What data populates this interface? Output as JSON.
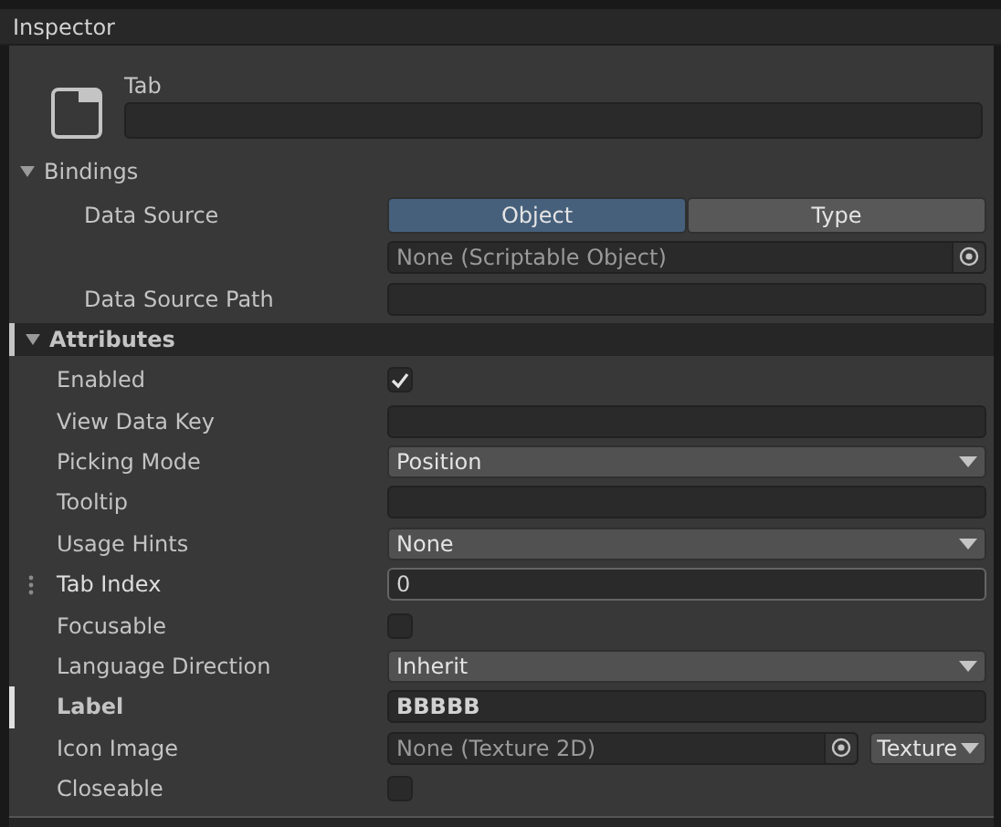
{
  "panel": {
    "title": "Inspector"
  },
  "element": {
    "type_name": "Tab"
  },
  "bindings": {
    "title": "Bindings",
    "expanded": true,
    "data_source": {
      "label": "Data Source",
      "options": [
        {
          "label": "Object",
          "selected": true
        },
        {
          "label": "Type",
          "selected": false
        }
      ],
      "value": "None (Scriptable Object)"
    },
    "data_source_path": {
      "label": "Data Source Path"
    }
  },
  "attributes": {
    "title": "Attributes",
    "expanded": true,
    "rows": [
      {
        "kind": "checkbox",
        "label": "Enabled",
        "checked": true,
        "modified": false,
        "hovered": false
      },
      {
        "kind": "text",
        "label": "View Data Key",
        "modified": false,
        "hovered": false
      },
      {
        "kind": "dropdown",
        "label": "Picking Mode",
        "value": "Position",
        "modified": false,
        "hovered": false
      },
      {
        "kind": "text",
        "label": "Tooltip",
        "modified": false,
        "hovered": false
      },
      {
        "kind": "dropdown",
        "label": "Usage Hints",
        "value": "None",
        "modified": false,
        "hovered": false
      },
      {
        "kind": "text",
        "label": "Tab Index",
        "value": "0",
        "modified": false,
        "hovered": true
      },
      {
        "kind": "checkbox",
        "label": "Focusable",
        "checked": false,
        "modified": false,
        "hovered": false
      },
      {
        "kind": "dropdown",
        "label": "Language Direction",
        "value": "Inherit",
        "modified": false,
        "hovered": false
      },
      {
        "kind": "text",
        "label": "Label",
        "value": "BBBBB",
        "modified": true,
        "hovered": false
      },
      {
        "kind": "object",
        "label": "Icon Image",
        "value": "None (Texture 2D)",
        "type_menu": "Texture",
        "modified": false,
        "hovered": false
      },
      {
        "kind": "checkbox",
        "label": "Closeable",
        "checked": false,
        "modified": false,
        "hovered": false
      }
    ]
  }
}
